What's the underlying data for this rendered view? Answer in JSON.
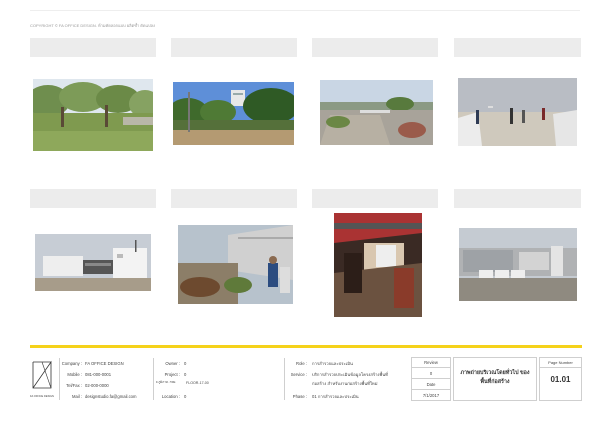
{
  "copyright": "COPYRIGHT © FA OFFICE DESIGN. ห้ามคัดลอกแบบ ผลิตซ้ำ ดัดแปลง",
  "title_block": {
    "company_label": "Company :",
    "company_value": "FA OFFICE DESIGN",
    "mobile_label": "Mobile :",
    "mobile_value": "081-000-0001",
    "telfax_label": "Tel/Fax :",
    "telfax_value": "02-000-0000",
    "mail_label": "Mail :",
    "mail_value": "designstudio.fa@gmail.com",
    "logo_caption": "FA OFFICE DESIGN",
    "owner_label": "Owner :",
    "owner_value": "0",
    "project_label": "Project :",
    "project_value": "0",
    "project_note": "F.ภูมิภาค. กทม.",
    "project_code": "FLOOR-17-00",
    "location_label": "Location :",
    "location_value": "0",
    "role_label": "Role :",
    "role_value": "การสำรวจและประเมิน",
    "service_label": "Service :",
    "service_line1": "บริการสำรวจประเมินข้อมูลโครงสร้างพื้นที่",
    "service_line2": "ก่อสร้าง สำหรับงานก่อสร้างพื้นที่ใหม่",
    "phase_label": "Phase :",
    "phase_value": "01    การสำรวจและประเมิน",
    "review_label": "Review",
    "review_value": "0",
    "date_label": "Date",
    "date_value": "7/1/2017",
    "sheet_title_line1": "ภาพถ่ายบริเวณโดยทั่วไป ของ",
    "sheet_title_line2": "พื้นที่ก่อสร้าง",
    "page_number_label": "Page Number",
    "page_number_value": "01.01"
  }
}
